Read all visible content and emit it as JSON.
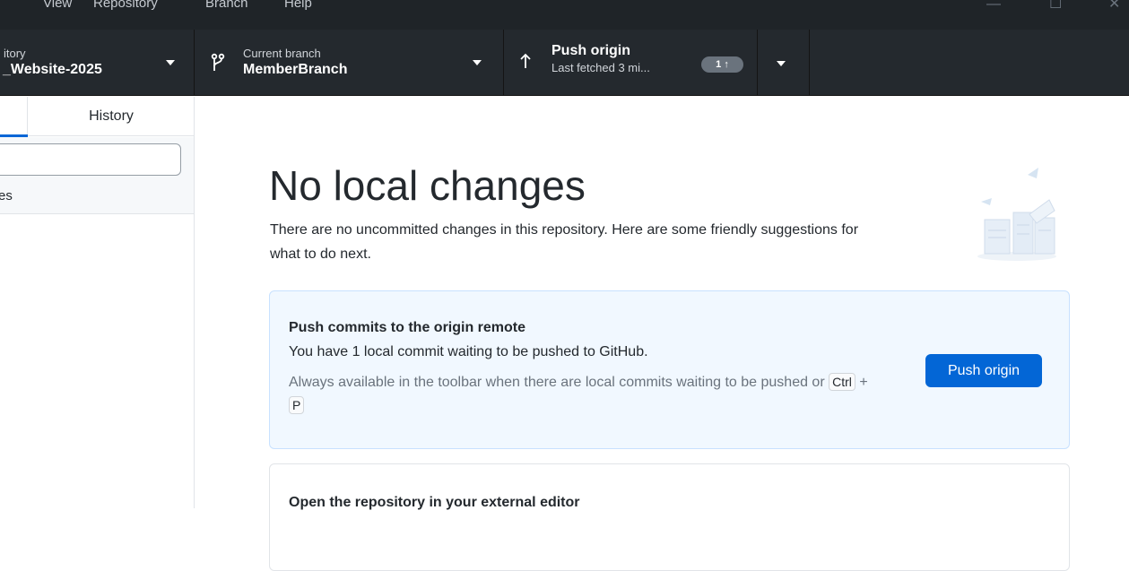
{
  "menu": {
    "items": [
      "View",
      "Repository",
      "Branch",
      "Help"
    ]
  },
  "window_controls": {
    "minimize": "—",
    "maximize": "☐",
    "close": "✕"
  },
  "toolbar": {
    "repository": {
      "label": "itory",
      "name": "_Website-2025"
    },
    "branch": {
      "label": "Current branch",
      "name": "MemberBranch"
    },
    "push": {
      "label": "Push origin",
      "subtitle": "Last fetched 3 mi...",
      "badge": "1 ↑"
    }
  },
  "sidebar": {
    "tabs": {
      "history": "History"
    },
    "changes_text": "es"
  },
  "main": {
    "title": "No local changes",
    "description": "There are no uncommitted changes in this repository. Here are some friendly suggestions for what to do next.",
    "push_card": {
      "title": "Push commits to the origin remote",
      "description": "You have 1 local commit waiting to be pushed to GitHub.",
      "hint_prefix": "Always available in the toolbar when there are local commits waiting to be pushed or",
      "key1": "Ctrl",
      "plus": "+",
      "key2": "P",
      "button": "Push origin"
    },
    "editor_card": {
      "title": "Open the repository in your external editor"
    }
  },
  "colors": {
    "toolbar_bg": "#24292e",
    "accent": "#0366d6",
    "card_bg": "#f1f8ff"
  }
}
